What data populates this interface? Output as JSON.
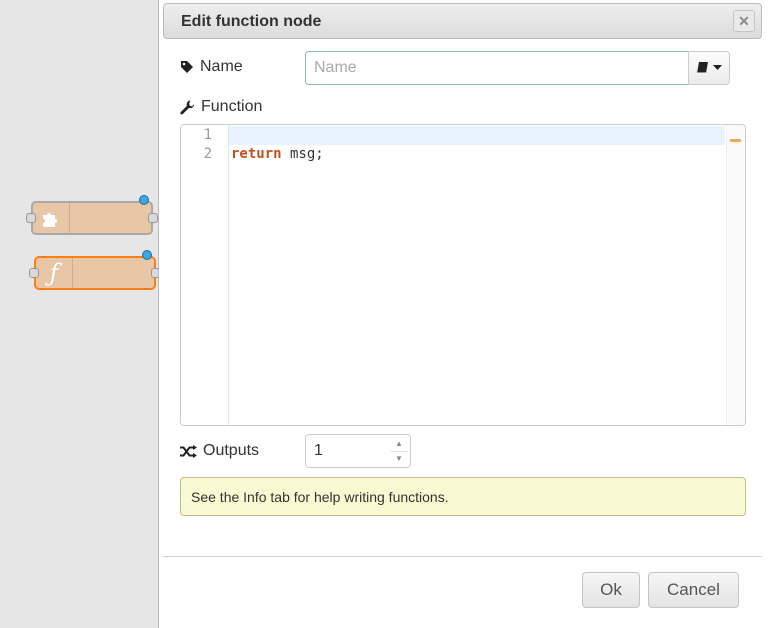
{
  "dialog": {
    "title": "Edit function node",
    "close_icon": "close-icon",
    "name_label": "Name",
    "name_value": "",
    "name_placeholder": "Name",
    "function_label": "Function",
    "code": {
      "line_numbers": [
        "1",
        "2"
      ],
      "line1": "",
      "line2_keyword": "return",
      "line2_rest": " msg;"
    },
    "outputs_label": "Outputs",
    "outputs_value": "1",
    "tip": "See the Info tab for help writing functions.",
    "ok_label": "Ok",
    "cancel_label": "Cancel"
  },
  "workspace": {
    "nodes": [
      {
        "icon": "puzzle-icon"
      },
      {
        "icon": "function-icon",
        "glyph": "ƒ"
      }
    ]
  },
  "colors": {
    "node_fill": "#e7c7a6",
    "selected_border": "#ff7f0e",
    "status_dot": "#3ca6e0",
    "tip_bg": "#fafad2",
    "keyword": "#c3511b"
  }
}
